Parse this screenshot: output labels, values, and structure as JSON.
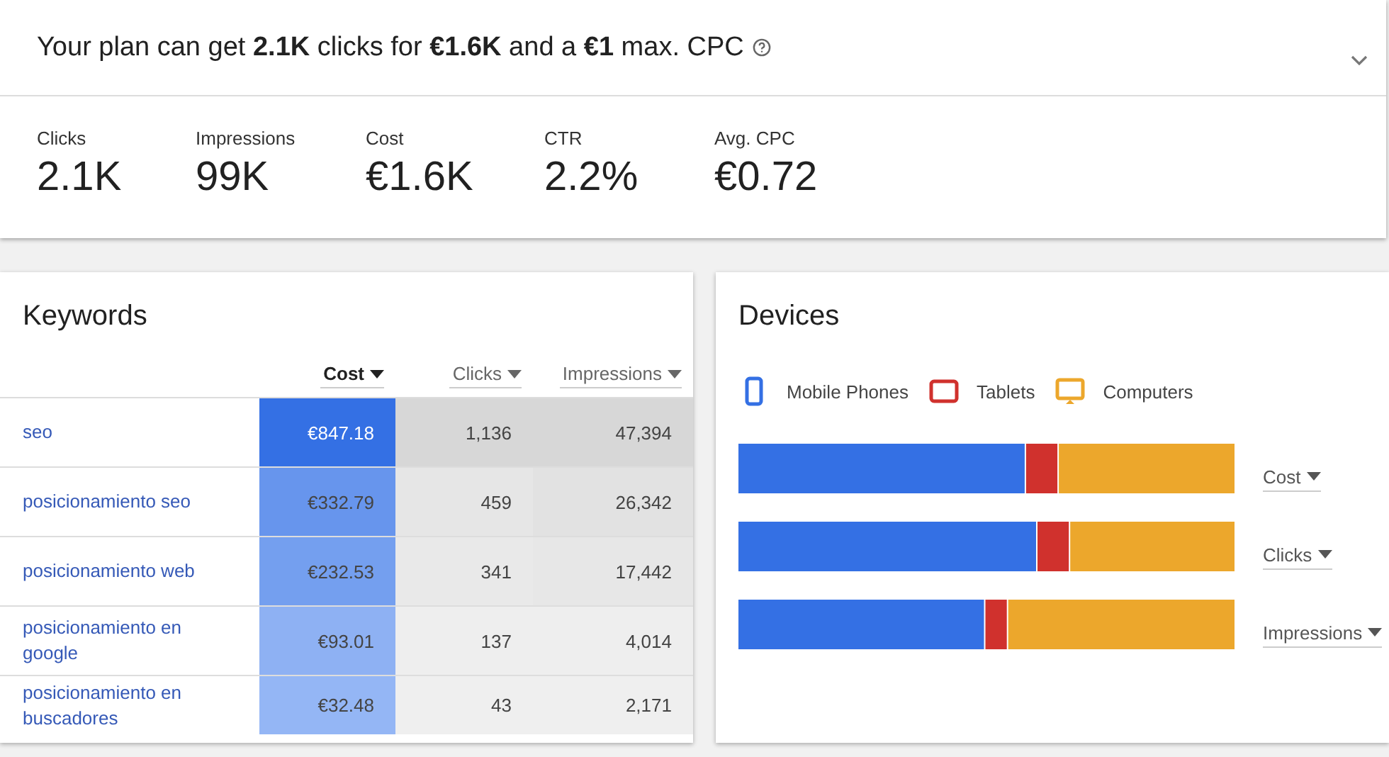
{
  "summary": {
    "headline": "Your plan can get **2.1K** clicks for **€1.6K** and a **€1** max. CPC",
    "metrics": [
      {
        "label": "Clicks",
        "value": "2.1K"
      },
      {
        "label": "Impressions",
        "value": "99K"
      },
      {
        "label": "Cost",
        "value": "€1.6K"
      },
      {
        "label": "CTR",
        "value": "2.2%"
      },
      {
        "label": "Avg. CPC",
        "value": "€0.72"
      }
    ]
  },
  "keywords": {
    "title": "Keywords",
    "columns": [
      {
        "label": "Cost",
        "selected": true
      },
      {
        "label": "Clicks",
        "selected": false
      },
      {
        "label": "Impressions",
        "selected": false
      }
    ],
    "rows": [
      {
        "keyword": "seo",
        "cells": [
          "€847.18",
          "1,136",
          "47,394"
        ]
      },
      {
        "keyword": "posicionamiento seo",
        "cells": [
          "€332.79",
          "459",
          "26,342"
        ]
      },
      {
        "keyword": "posicionamiento web",
        "cells": [
          "€232.53",
          "341",
          "17,442"
        ]
      },
      {
        "keyword": "posicionamiento en google",
        "cells": [
          "€93.01",
          "137",
          "4,014"
        ]
      },
      {
        "keyword": "posicionamiento en buscadores",
        "cells": [
          "€32.48",
          "43",
          "2,171"
        ]
      }
    ]
  },
  "devices": {
    "title": "Devices",
    "legend": [
      {
        "label": "Mobile Phones",
        "kind": "phone",
        "color": "#3470e4"
      },
      {
        "label": "Tablets",
        "kind": "tablet",
        "color": "#d0312d"
      },
      {
        "label": "Computers",
        "kind": "computer",
        "color": "#eca72c"
      }
    ],
    "metrics": [
      {
        "label": "Cost"
      },
      {
        "label": "Clicks"
      },
      {
        "label": "Impressions"
      }
    ]
  }
}
